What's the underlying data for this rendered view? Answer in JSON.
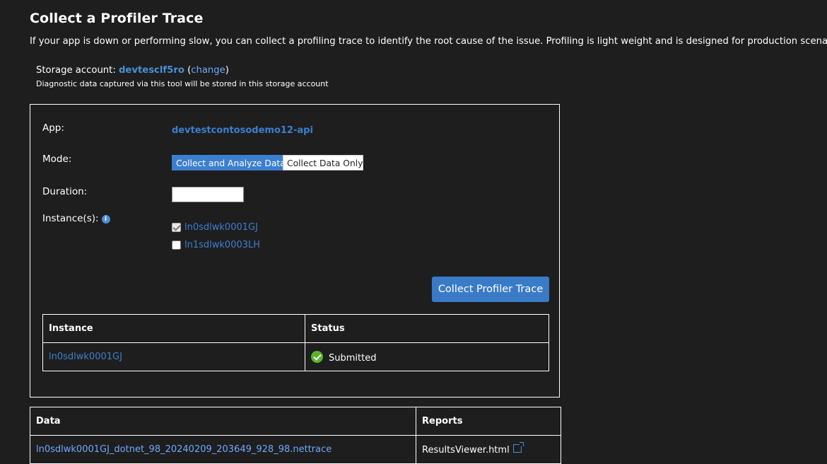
{
  "header": {
    "title": "Collect a Profiler Trace",
    "description": "If your app is down or performing slow, you can collect a profiling trace to identify the root cause of the issue. Profiling is light weight and is designed for production scenarios."
  },
  "storage": {
    "label": "Storage account:",
    "account": "devtesclf5ro",
    "open_paren": " (",
    "change_link": "change",
    "close_paren": ")",
    "note": "Diagnostic data captured via this tool will be stored in this storage account"
  },
  "form": {
    "app_label": "App:",
    "app_name": "devtestcontosodemo12-api",
    "mode_label": "Mode:",
    "mode_options": [
      "Collect and Analyze Data",
      "Collect Data Only"
    ],
    "mode_selected": "Collect and Analyze Data",
    "duration_label": "Duration:",
    "duration_value": "",
    "instances_label": "Instance(s):",
    "info_icon": "info-icon",
    "instances": [
      {
        "name": "ln0sdlwk0001GJ",
        "checked": true
      },
      {
        "name": "ln1sdlwk0003LH",
        "checked": false
      }
    ],
    "collect_button": "Collect Profiler Trace"
  },
  "status_table": {
    "headers": [
      "Instance",
      "Status"
    ],
    "rows": [
      {
        "instance": "ln0sdlwk0001GJ",
        "status": "Submitted",
        "status_icon": "check-circle-icon"
      }
    ]
  },
  "data_table": {
    "headers": [
      "Data",
      "Reports"
    ],
    "rows": [
      {
        "data": "ln0sdlwk0001GJ_dotnet_98_20240209_203649_928_98.nettrace",
        "report": "ResultsViewer.html",
        "report_icon": "external-link-icon"
      }
    ]
  },
  "colors": {
    "background": "#1e1e1e",
    "accent": "#3c7fcf",
    "link": "#6fa8ff",
    "success": "#5bb52a"
  }
}
